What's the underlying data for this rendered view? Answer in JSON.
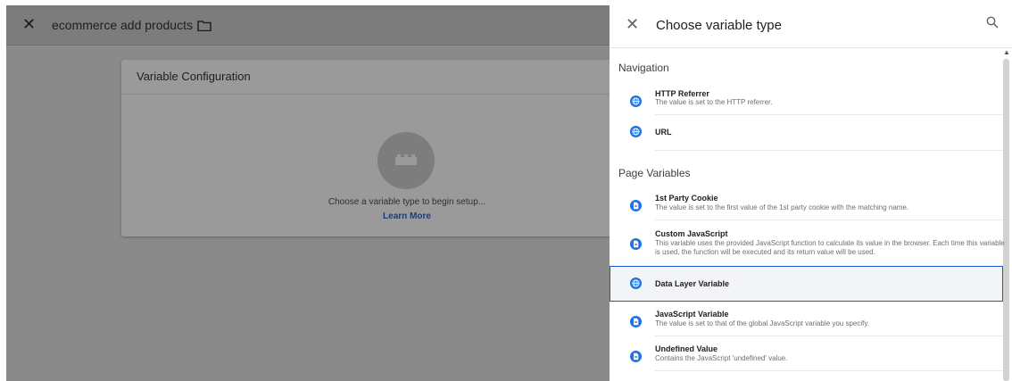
{
  "editor": {
    "tag_title": "ecommerce add products",
    "card": {
      "header": "Variable Configuration",
      "hint": "Choose a variable type to begin setup...",
      "learn_more": "Learn More"
    }
  },
  "panel": {
    "title": "Choose variable type",
    "sections": {
      "navigation": "Navigation",
      "page_variables": "Page Variables"
    },
    "items": [
      {
        "name": "HTTP Referrer",
        "desc": "The value is set to the HTTP referrer.",
        "icon": "globe-icon"
      },
      {
        "name": "URL",
        "desc": "",
        "icon": "globe-icon"
      },
      {
        "name": "1st Party Cookie",
        "desc": "The value is set to the first value of the 1st party cookie with the matching name.",
        "icon": "document-icon"
      },
      {
        "name": "Custom JavaScript",
        "desc": "This variable uses the provided JavaScript function to calculate its value in the browser. Each time this variable is used, the function will be executed and its return value will be used.",
        "icon": "document-icon"
      },
      {
        "name": "Data Layer Variable",
        "desc": "",
        "icon": "globe-icon",
        "selected": true
      },
      {
        "name": "JavaScript Variable",
        "desc": "The value is set to that of the global JavaScript variable you specify.",
        "icon": "document-icon"
      },
      {
        "name": "Undefined Value",
        "desc": "Contains the JavaScript 'undefined' value.",
        "icon": "document-icon"
      }
    ]
  },
  "colors": {
    "accent": "#1a73e8",
    "selection_border": "#1a56db",
    "overlay": "#8a8a8a"
  }
}
